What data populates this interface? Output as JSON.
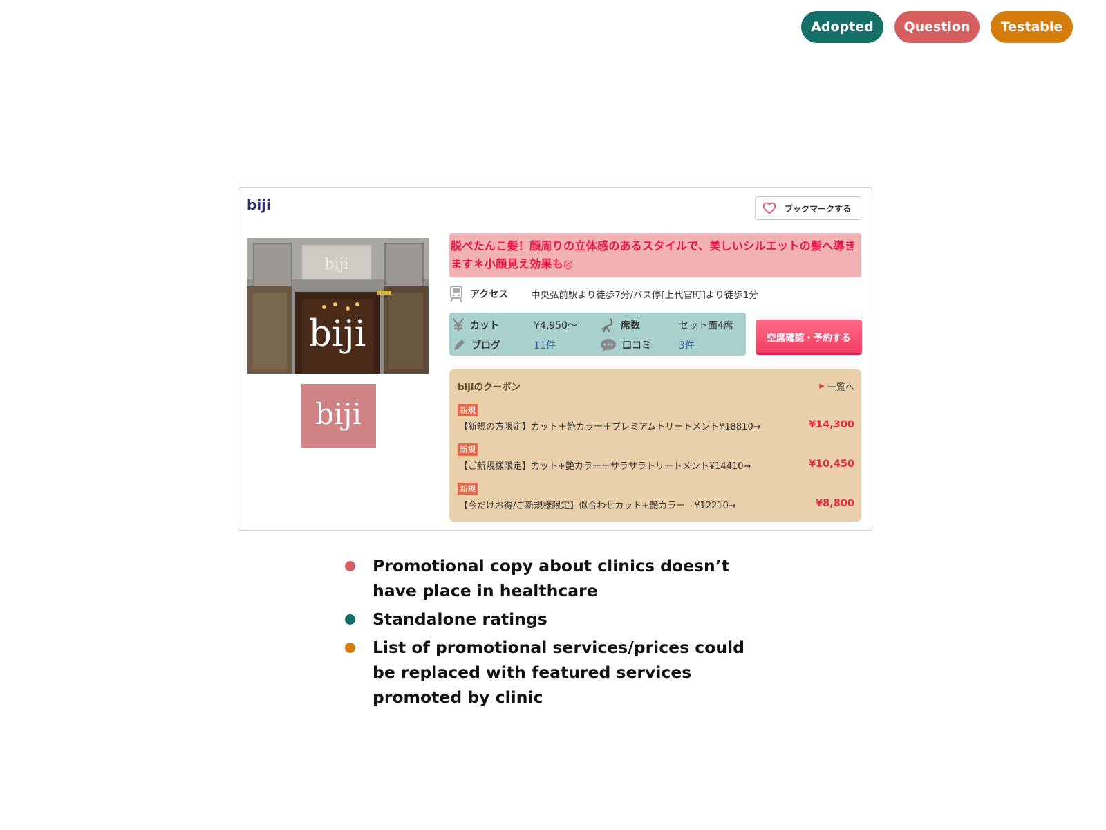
{
  "tags": [
    {
      "label": "Adopted",
      "color": "#146f68"
    },
    {
      "label": "Question",
      "color": "#d6605f"
    },
    {
      "label": "Testable",
      "color": "#d47c0c"
    }
  ],
  "card": {
    "salon_name": "biji",
    "bookmark_label": "ブックマークする",
    "photo_logo_text": "biji",
    "catch_copy": "脱ぺたんこ髪！顔周りの立体感のあるスタイルで、美しいシルエットの髪へ導きます＊小顔見え効果も◎",
    "access": {
      "label": "アクセス",
      "value": "中央弘前駅より徒歩7分/バス停[上代官町]より徒歩1分"
    },
    "info": {
      "cut_label": "カット",
      "cut_value": "¥4,950〜",
      "seats_label": "席数",
      "seats_value": "セット面4席",
      "blog_label": "ブログ",
      "blog_value": "11件",
      "review_label": "口コミ",
      "review_value": "3件"
    },
    "reserve_label": "空席確認・予約する",
    "coupons": {
      "title": "bijiのクーポン",
      "more_label": "一覧へ",
      "items": [
        {
          "badge": "新規",
          "text": "【新規の方限定】カット＋艶カラー＋プレミアムトリートメント¥18810→",
          "price": "¥14,300"
        },
        {
          "badge": "新規",
          "text": "【ご新規様限定】カット+艶カラー＋サラサラトリートメント¥14410→",
          "price": "¥10,450"
        },
        {
          "badge": "新規",
          "text": "【今だけお得/ご新規様限定】似合わせカット+艶カラー　¥12210→",
          "price": "¥8,800"
        }
      ]
    }
  },
  "notes": [
    {
      "text": "Promotional copy about clinics doesn’t have place in healthcare",
      "color": "#d6605f"
    },
    {
      "text": "Standalone ratings",
      "color": "#146f68"
    },
    {
      "text": "List of promotional services/prices could be replaced with featured services promoted by clinic",
      "color": "#d47c0c"
    }
  ]
}
